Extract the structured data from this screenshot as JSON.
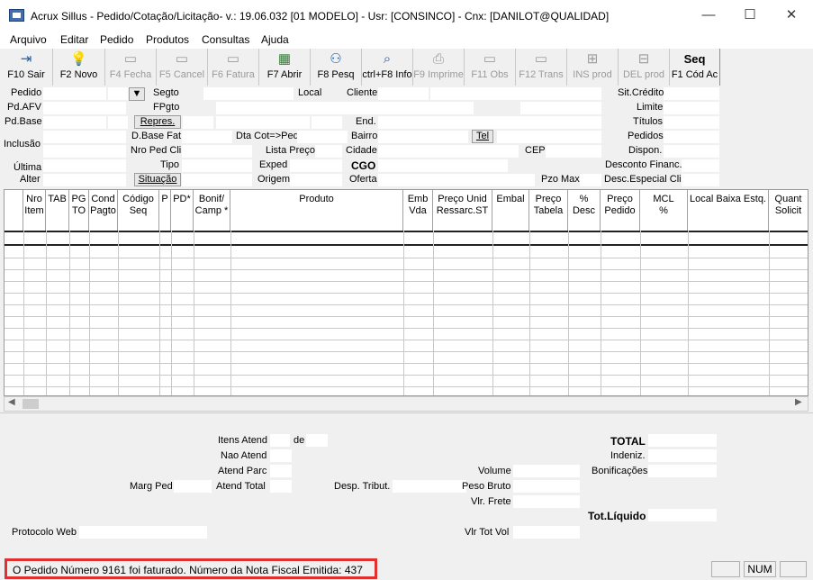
{
  "window": {
    "title": "Acrux Sillus - Pedido/Cotação/Licitação- v.: 19.06.032  [01 MODELO] - Usr: [CONSINCO] - Cnx: [DANILOT@QUALIDAD]",
    "minimize": "—",
    "maximize": "☐",
    "close": "✕"
  },
  "menu": [
    "Arquivo",
    "Editar",
    "Pedido",
    "Produtos",
    "Consultas",
    "Ajuda"
  ],
  "toolbar": {
    "sair": "F10 Sair",
    "novo": "F2 Novo",
    "fecha": "F4 Fecha",
    "cancel": "F5 Cancel",
    "fatura": "F6 Fatura",
    "abrir": "F7 Abrir",
    "pesq": "F8 Pesq",
    "info": "ctrl+F8 Info",
    "imprime": "F9 Imprime",
    "obs": "F11 Obs",
    "trans": "F12 Trans",
    "insprod": "INS prod",
    "delprod": "DEL prod",
    "seq": "Seq",
    "codac": "F1 Cód Ac"
  },
  "form": {
    "pedido": "Pedido",
    "segto": "Segto",
    "local": "Local",
    "cliente": "Cliente",
    "sit_credito": "Sit.Crédito",
    "pd_afv": "Pd.AFV",
    "fpgto": "FPgto",
    "limite": "Limite",
    "pd_base": "Pd.Base",
    "repres": "Repres.",
    "end": "End.",
    "titulos": "Títulos",
    "d_base_fat": "D.Base Fat",
    "dta_cot_ped": "Dta Cot=>Ped",
    "bairro": "Bairro",
    "tel": "Tel",
    "pedidos": "Pedidos",
    "inclusao": "Inclusão",
    "nro_ped_cli": "Nro Ped Cli",
    "lista_preco": "Lista Preço",
    "cidade": "Cidade",
    "cep": "CEP",
    "dispon": "Dispon.",
    "ultima": "Última",
    "tipo": "Tipo",
    "exped": "Exped",
    "cgo": "CGO",
    "desconto_financ": "Desconto Financ.",
    "alter": "Alter",
    "situacao": "Situação",
    "origem": "Origem",
    "oferta": "Oferta",
    "pzo_max": "Pzo Max",
    "desc_especial": "Desc.Especial Cli."
  },
  "grid": {
    "columns": [
      [
        "Nro",
        "Item"
      ],
      [
        "TAB",
        ""
      ],
      [
        "PG",
        "TO"
      ],
      [
        "Cond",
        "Pagto"
      ],
      [
        "Código",
        "Seq"
      ],
      [
        "P",
        ""
      ],
      [
        "PD*",
        ""
      ],
      [
        "Bonif/",
        "Camp *"
      ],
      [
        "Produto",
        ""
      ],
      [
        "Emb",
        "Vda"
      ],
      [
        "Preço Unid",
        "Ressarc.ST"
      ],
      [
        "Embal",
        ""
      ],
      [
        "Preço",
        "Tabela"
      ],
      [
        "%",
        "Desc"
      ],
      [
        "Preço",
        "Pedido"
      ],
      [
        "MCL",
        "%"
      ],
      [
        "Local Baixa Estq.",
        ""
      ],
      [
        "Quant",
        "Solicit"
      ]
    ]
  },
  "totals": {
    "itens_atend": "Itens Atend",
    "de": "de",
    "nao_atend": "Nao Atend",
    "atend_parc": "Atend Parc",
    "marg_ped": "Marg Ped",
    "atend_total": "Atend Total",
    "desp_tribut": "Desp. Tribut.",
    "volume": "Volume",
    "peso_bruto": "Peso Bruto",
    "vlr_frete": "Vlr. Frete",
    "total": "TOTAL",
    "indeniz": "Indeniz.",
    "bonificacoes": "Bonificações",
    "tot_liquido": "Tot.Líquido",
    "protocolo_web": "Protocolo Web",
    "vlr_tot_vol": "Vlr Tot Vol"
  },
  "status": {
    "message": "O Pedido Número 9161 foi faturado. Número da Nota Fiscal Emitida: 437",
    "num": "NUM"
  },
  "colors": {
    "highlight": "#e03030",
    "toolbar_accent": "#1d5fa8"
  }
}
